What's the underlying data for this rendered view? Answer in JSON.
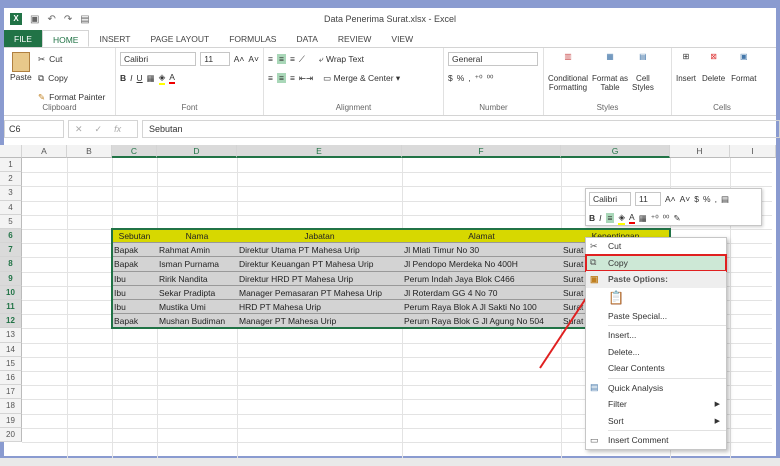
{
  "window": {
    "title": "Data Penerima Surat.xlsx - Excel"
  },
  "tabs": [
    "FILE",
    "HOME",
    "INSERT",
    "PAGE LAYOUT",
    "FORMULAS",
    "DATA",
    "REVIEW",
    "VIEW"
  ],
  "ribbon": {
    "clipboard": {
      "paste": "Paste",
      "cut": "Cut",
      "copy": "Copy",
      "format_painter": "Format Painter",
      "label": "Clipboard"
    },
    "font": {
      "name": "Calibri",
      "size": "11",
      "label": "Font"
    },
    "alignment": {
      "wrap": "Wrap Text",
      "merge": "Merge & Center",
      "label": "Alignment"
    },
    "number": {
      "format": "General",
      "currency": "$",
      "percent": "%",
      "comma": ",",
      "label": "Number"
    },
    "styles": {
      "conditional": "Conditional",
      "conditional2": "Formatting",
      "format_as": "Format as",
      "format_as2": "Table",
      "cell": "Cell",
      "cell2": "Styles",
      "label": "Styles"
    },
    "cells": {
      "insert": "Insert",
      "delete": "Delete",
      "format": "Format",
      "label": "Cells"
    }
  },
  "formula_bar": {
    "name_box": "C6",
    "value": "Sebutan"
  },
  "columns": [
    "A",
    "B",
    "C",
    "D",
    "E",
    "F",
    "G",
    "H",
    "I"
  ],
  "rows": [
    "1",
    "2",
    "3",
    "4",
    "5",
    "6",
    "7",
    "8",
    "9",
    "10",
    "11",
    "12",
    "13",
    "14",
    "15",
    "16",
    "17",
    "18",
    "19",
    "20"
  ],
  "table": {
    "headers": [
      "Sebutan",
      "Nama",
      "Jabatan",
      "Alamat",
      "Kepentingan"
    ],
    "rows": [
      [
        "Bapak",
        "Rahmat Amin",
        "Direktur Utama PT Mahesa Urip",
        "Jl Mlati Timur No 30",
        "Surat"
      ],
      [
        "Bapak",
        "Isman Purnama",
        "Direktur Keuangan PT Mahesa Urip",
        "Jl Pendopo Merdeka No 400H",
        "Surat"
      ],
      [
        "Ibu",
        "Ririk Nandita",
        "Direktur HRD PT Mahesa Urip",
        "Perum Indah Jaya Blok C466",
        "Surat"
      ],
      [
        "Ibu",
        "Sekar Pradipta",
        "Manager Pemasaran PT Mahesa Urip",
        "Jl Roterdam GG 4 No 70",
        "Surat"
      ],
      [
        "Ibu",
        "Mustika Umi",
        "HRD PT Mahesa Urip",
        "Perum Raya Blok A Jl Sakti No 100",
        "Surat"
      ],
      [
        "Bapak",
        "Mushan Budiman",
        "Manager PT Mahesa Urip",
        "Perum Raya Blok G Jl Agung No 504",
        "Surat"
      ]
    ]
  },
  "mini_toolbar": {
    "font": "Calibri",
    "size": "11",
    "currency": "$",
    "percent": "%",
    "comma": ","
  },
  "context_menu": {
    "cut": "Cut",
    "copy": "Copy",
    "paste_options": "Paste Options:",
    "paste_special": "Paste Special...",
    "insert": "Insert...",
    "delete": "Delete...",
    "clear": "Clear Contents",
    "quick_analysis": "Quick Analysis",
    "filter": "Filter",
    "sort": "Sort",
    "insert_comment": "Insert Comment"
  },
  "colors": {
    "accent": "#217346",
    "header_fill": "#d7d800",
    "highlight": "#e02020"
  }
}
